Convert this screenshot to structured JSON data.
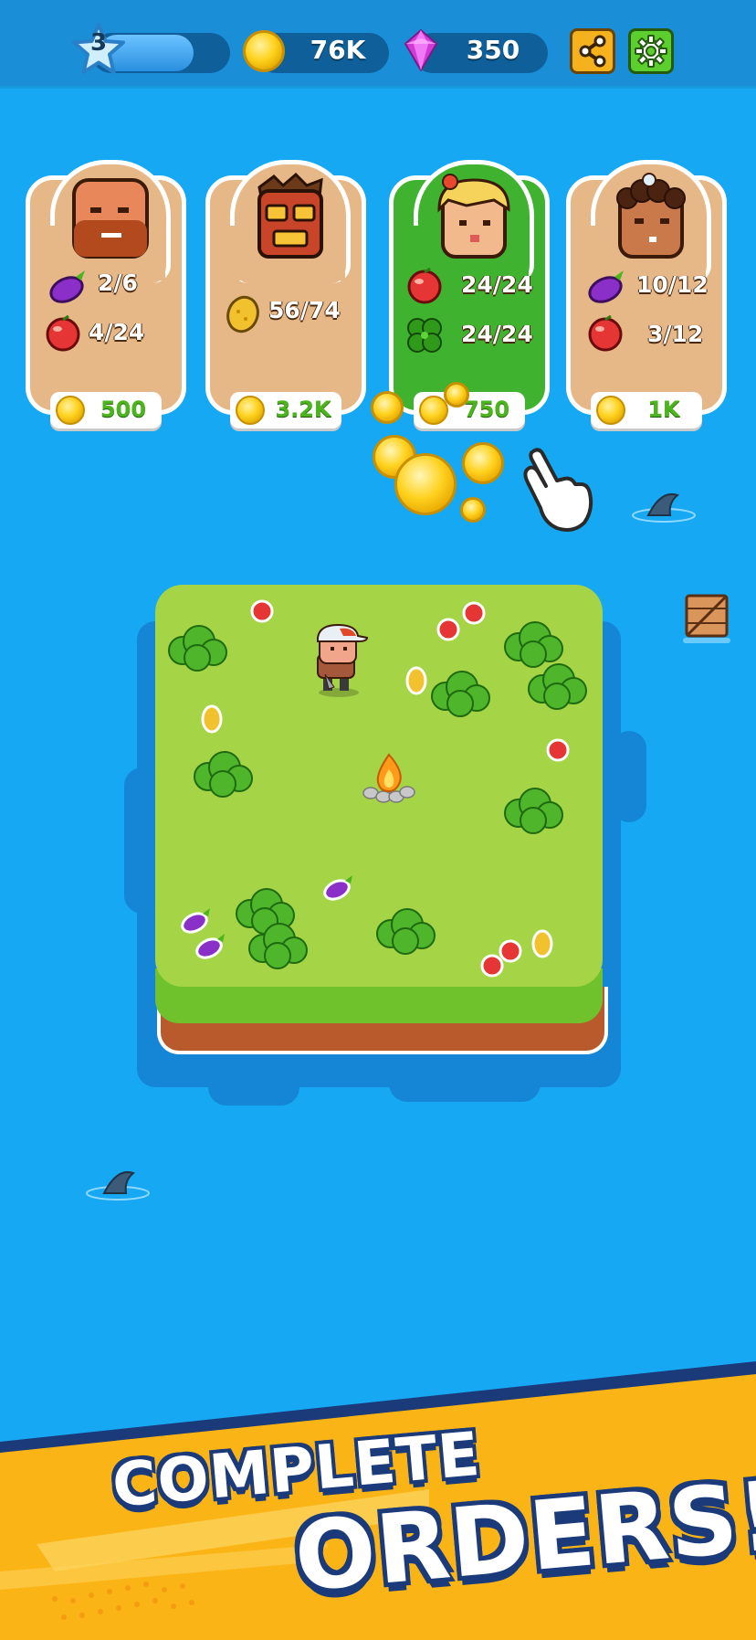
{
  "hud": {
    "level": "3",
    "xp_progress": 0.72,
    "coins": "76K",
    "gems": "350",
    "share_icon": "share-icon",
    "settings_icon": "gear-icon"
  },
  "orders": [
    {
      "character": "bald-bearded-man",
      "state": "in-progress",
      "items": [
        {
          "icon": "eggplant-icon",
          "progress": "2/6"
        },
        {
          "icon": "apple-icon",
          "progress": "4/24"
        }
      ],
      "reward": "500"
    },
    {
      "character": "tiki-mask",
      "state": "in-progress",
      "items": [
        {
          "icon": "mango-icon",
          "progress": "56/74"
        }
      ],
      "reward": "3.2K"
    },
    {
      "character": "blonde-girl",
      "state": "completed",
      "items": [
        {
          "icon": "apple-icon",
          "progress": "24/24"
        },
        {
          "icon": "clover-icon",
          "progress": "24/24"
        }
      ],
      "reward": "750"
    },
    {
      "character": "curly-hair-chef",
      "state": "in-progress",
      "items": [
        {
          "icon": "eggplant-icon",
          "progress": "10/12"
        },
        {
          "icon": "apple-icon",
          "progress": "3/12"
        }
      ],
      "reward": "1K"
    }
  ],
  "banner": {
    "line1": "COMPLETE",
    "line2": "ORDERS!"
  },
  "colors": {
    "sea": "#16a8f2",
    "grass": "#a5d447",
    "card": "#e7b887",
    "card_done": "#3fb22f",
    "banner": "#fbb415"
  }
}
